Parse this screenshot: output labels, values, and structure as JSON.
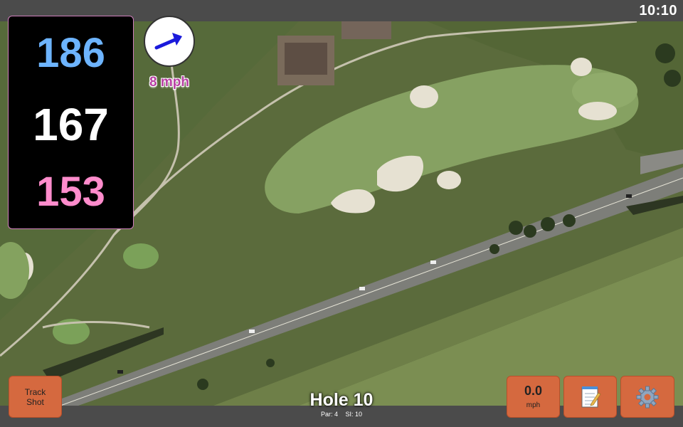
{
  "status": {
    "time": "10:10"
  },
  "yardages": {
    "back": "186",
    "center": "167",
    "front": "153"
  },
  "wind": {
    "speed": "8 mph",
    "icon": "wind-arrow-icon",
    "arrow_color": "#1a1adb"
  },
  "buttons": {
    "track_shot": {
      "line1": "Track",
      "line2": "Shot"
    },
    "speed": {
      "value": "0.0",
      "unit": "mph"
    },
    "notes": {
      "icon": "notepad-icon"
    },
    "settings": {
      "icon": "gear-icon"
    }
  },
  "hole": {
    "title": "Hole 10",
    "par": "Par: 4",
    "si": "SI: 10"
  },
  "colors": {
    "button": "#d5693f",
    "back_yardage": "#6db4ff",
    "front_yardage": "#ff8ccc",
    "wind_text": "#b73fa3"
  }
}
